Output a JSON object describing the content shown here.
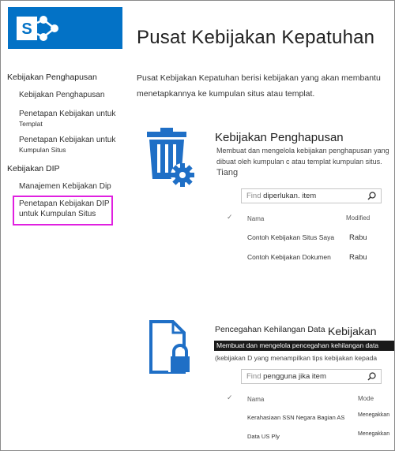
{
  "header": {
    "title": "Pusat Kebijakan Kepatuhan"
  },
  "nav": {
    "group1": "Kebijakan Penghapusan",
    "item1": "Kebijakan Penghapusan",
    "item2a": "Penetapan Kebijakan untuk",
    "item2b": "Templat",
    "item3a": "Penetapan Kebijakan untuk",
    "item3b": "Kumpulan Situs",
    "group2": "Kebijakan DIP",
    "item4": "Manajemen Kebijakan Dip",
    "item5a": "Penetapan Kebijakan DIP",
    "item5b": "untuk Kumpulan Situs"
  },
  "intro": {
    "line1": "Pusat Kebijakan Kepatuhan berisi kebijakan yang akan membantu",
    "line2": "menetapkannya ke kumpulan situs atau templat."
  },
  "deletion": {
    "title": "Kebijakan Penghapusan",
    "desc1": "Membuat dan mengelola kebijakan penghapusan yang",
    "desc2": "dibuat oleh kumpulan c atau templat kumpulan situs.",
    "desc3": "Tiang",
    "search_ph": "Find",
    "search_val": "diperlukan. item",
    "col_name": "Nama",
    "col_modified": "Modified",
    "rows": [
      {
        "name": "Contoh Kebijakan Situs Saya",
        "modified": "Rabu"
      },
      {
        "name": "Contoh Kebijakan Dokumen",
        "modified": "Rabu"
      }
    ]
  },
  "dlp": {
    "title1": "Pencegahan Kehilangan Data",
    "title2": "Kebijakan",
    "desc1": "Membuat dan mengelola pencegahan kehilangan data",
    "desc2": "(kebijakan D yang menampilkan tips kebijakan kepada",
    "search_ph": "Find",
    "search_val": "pengguna jika item",
    "col_name": "Nama",
    "col_mode": "Mode",
    "rows": [
      {
        "name": "Kerahasiaan SSN Negara Bagian AS",
        "mode": "Menegakkan"
      },
      {
        "name": "Data US Ply",
        "mode": "Menegakkan"
      }
    ]
  },
  "colors": {
    "brand": "#0372c6",
    "icon": "#1f6fc6",
    "highlight": "#e020e0"
  },
  "icons": {
    "logo": "sharepoint-logo-icon",
    "deletion": "trash-gear-icon",
    "dlp": "document-lock-icon",
    "search": "search-icon",
    "check": "check-icon"
  }
}
